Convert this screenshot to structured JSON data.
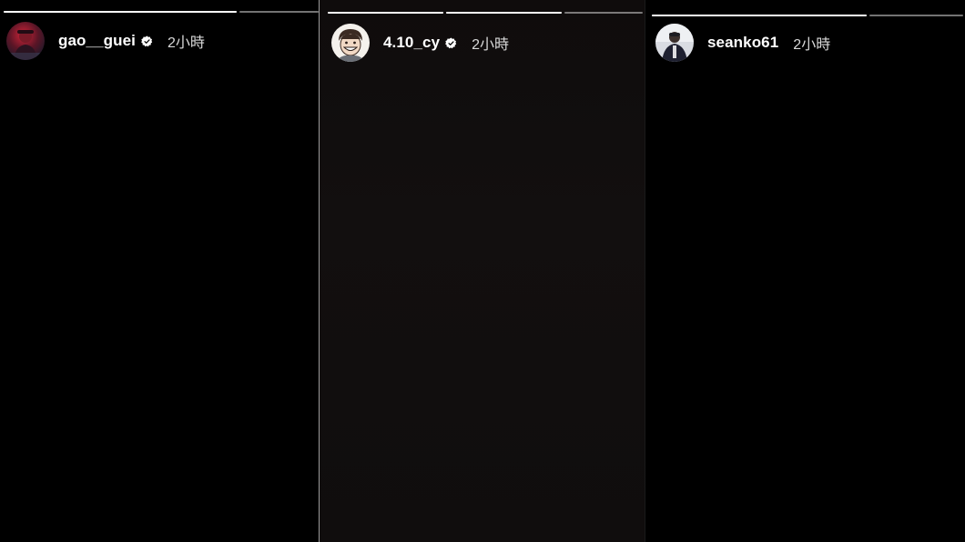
{
  "stories": [
    {
      "username": "gao__guei",
      "verified": true,
      "time": "2小時",
      "avatar_icon": "avatar-person-red-light",
      "progress": [
        1,
        0
      ]
    },
    {
      "username": "4.10_cy",
      "verified": true,
      "time": "2小時",
      "avatar_icon": "avatar-cartoon-smiling-face",
      "progress": [
        1,
        1,
        0
      ]
    },
    {
      "username": "seanko61",
      "verified": false,
      "time": "2小時",
      "avatar_icon": "avatar-person-dark-jacket",
      "progress": [
        1,
        0
      ]
    }
  ],
  "colors": {
    "background": "#000000",
    "progress_track": "rgba(255,255,255,0.45)",
    "progress_fill": "#ffffff",
    "username": "#ffffff",
    "time": "#d8d8d8"
  }
}
